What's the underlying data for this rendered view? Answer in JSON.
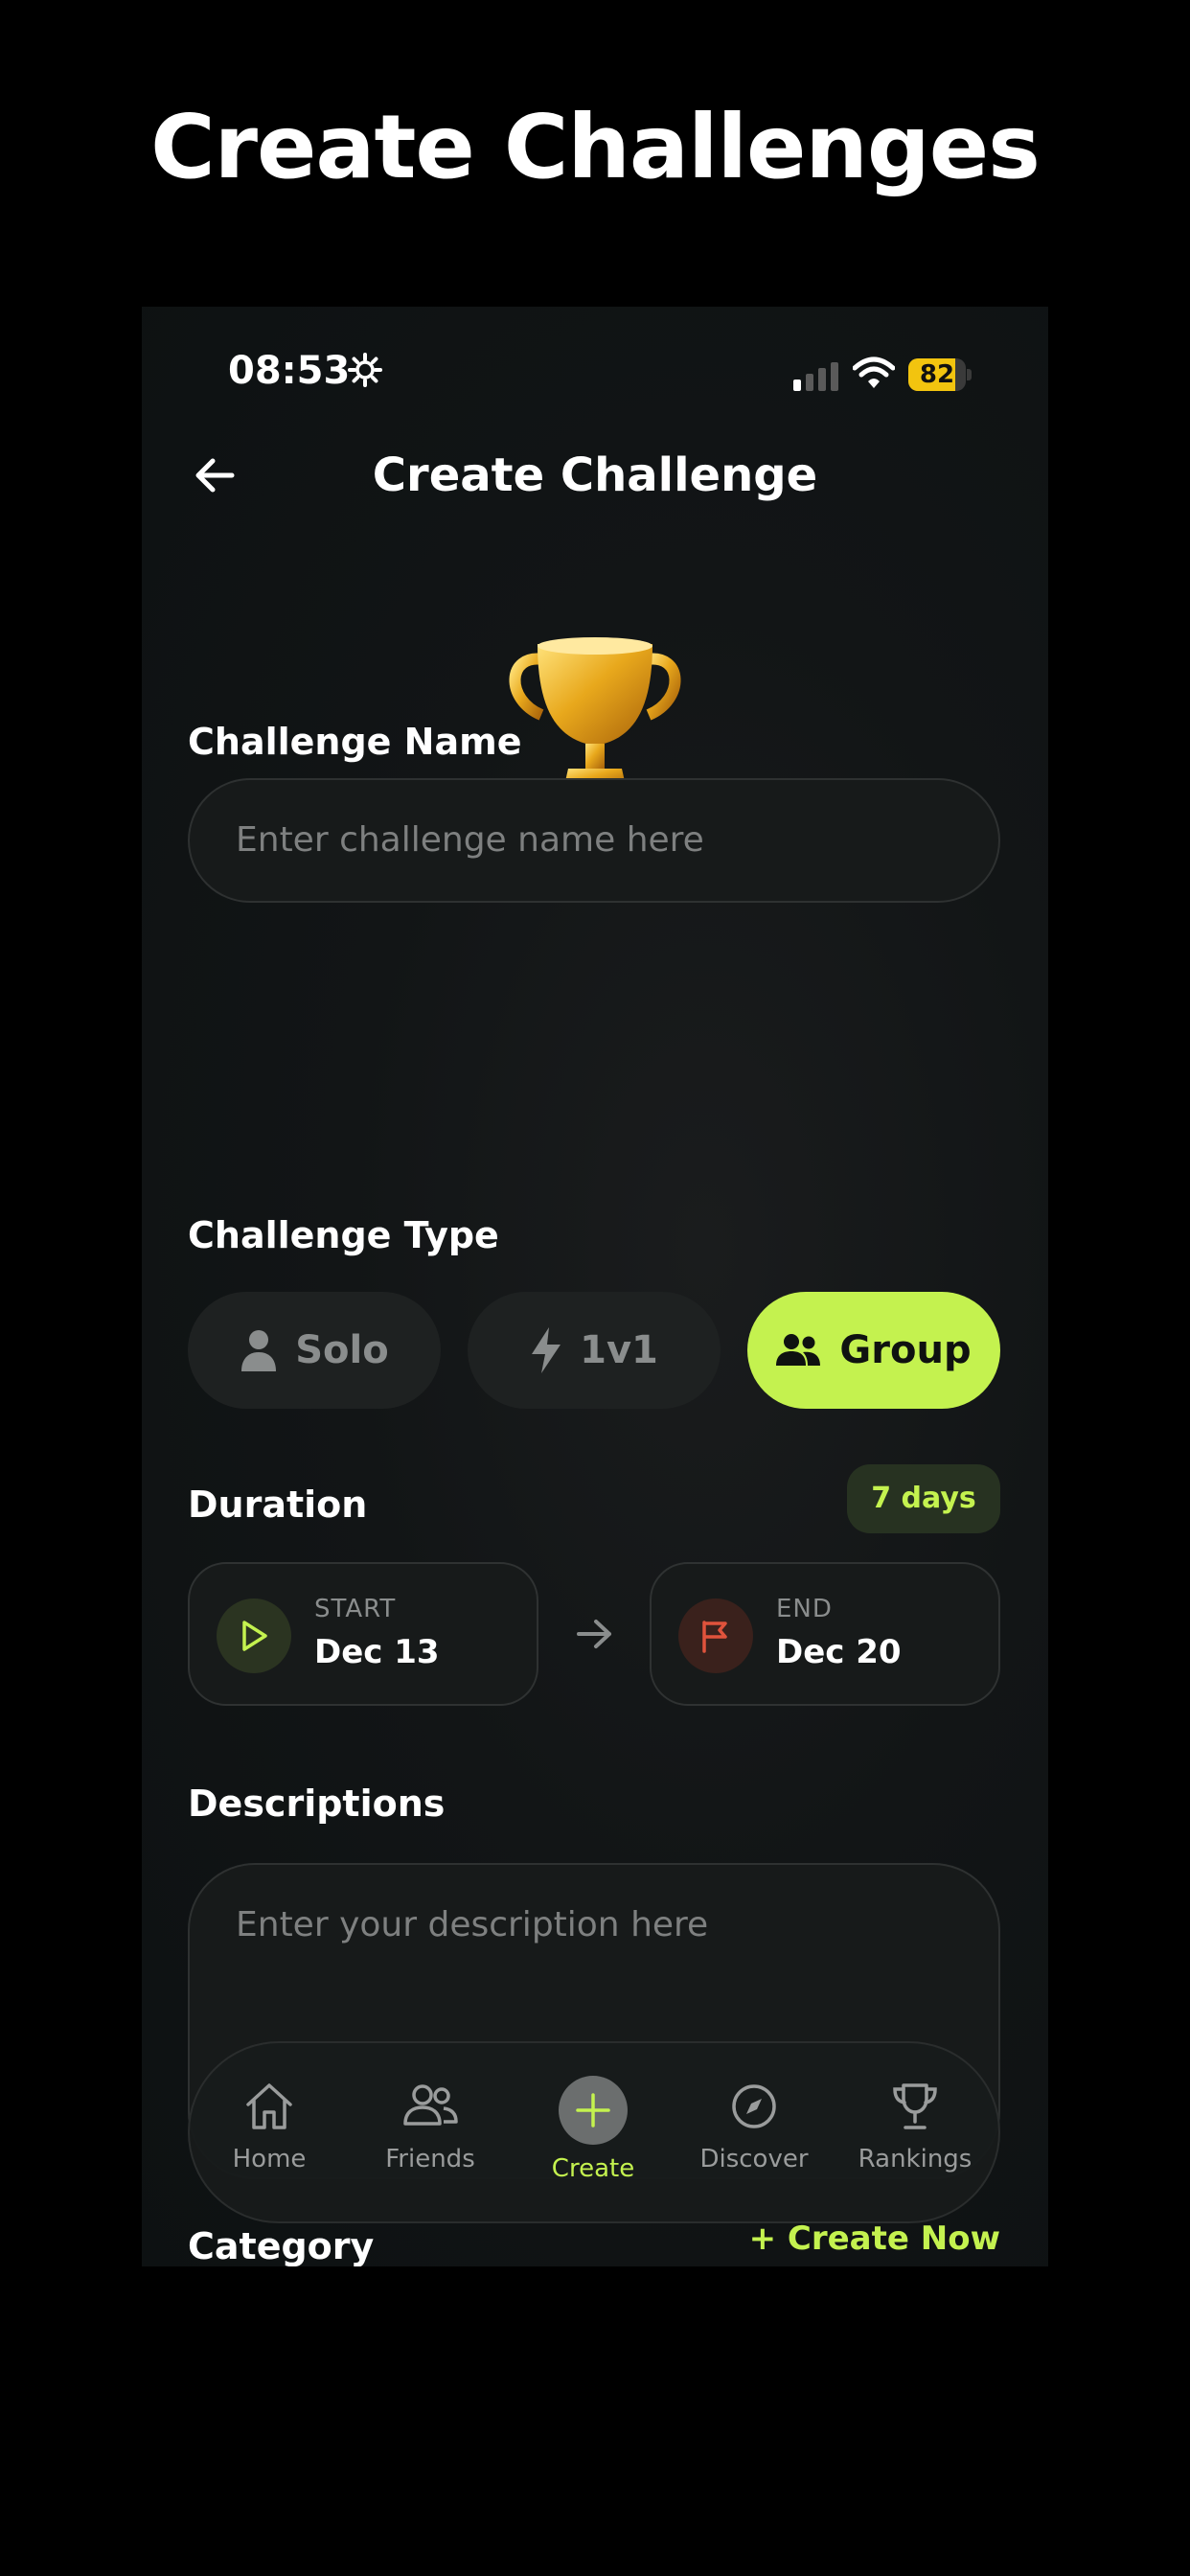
{
  "promo": {
    "title": "Create Challenges"
  },
  "status_bar": {
    "time": "08:53",
    "battery": "82",
    "battery_level": 0.82
  },
  "header": {
    "title": "Create Challenge",
    "back_icon": "arrow-left-icon"
  },
  "avatar": {
    "icon": "trophy-icon",
    "camera_icon": "camera-icon"
  },
  "challenge_name": {
    "label": "Challenge Name",
    "placeholder": "Enter challenge name here"
  },
  "challenge_type": {
    "label": "Challenge Type",
    "options": [
      {
        "label": "Solo",
        "icon": "person-icon",
        "selected": false
      },
      {
        "label": "1v1",
        "icon": "lightning-icon",
        "selected": false
      },
      {
        "label": "Group",
        "icon": "group-icon",
        "selected": true
      }
    ]
  },
  "duration": {
    "label": "Duration",
    "badge": "7 days",
    "start": {
      "label": "START",
      "value": "Dec 13",
      "icon": "play-icon"
    },
    "end": {
      "label": "END",
      "value": "Dec 20",
      "icon": "flag-icon"
    }
  },
  "descriptions": {
    "label": "Descriptions",
    "placeholder": "Enter your description here"
  },
  "bottom_nav": {
    "items": [
      {
        "label": "Home",
        "icon": "home-icon"
      },
      {
        "label": "Friends",
        "icon": "friends-icon"
      },
      {
        "label": "Create",
        "icon": "plus-icon",
        "active": true
      },
      {
        "label": "Discover",
        "icon": "compass-icon"
      },
      {
        "label": "Rankings",
        "icon": "trophy-outline-icon"
      }
    ]
  },
  "category": {
    "label": "Category",
    "action": "+ Create Now"
  },
  "colors": {
    "accent": "#c4f24f",
    "background": "#121516",
    "end_icon": "#e0533c"
  }
}
